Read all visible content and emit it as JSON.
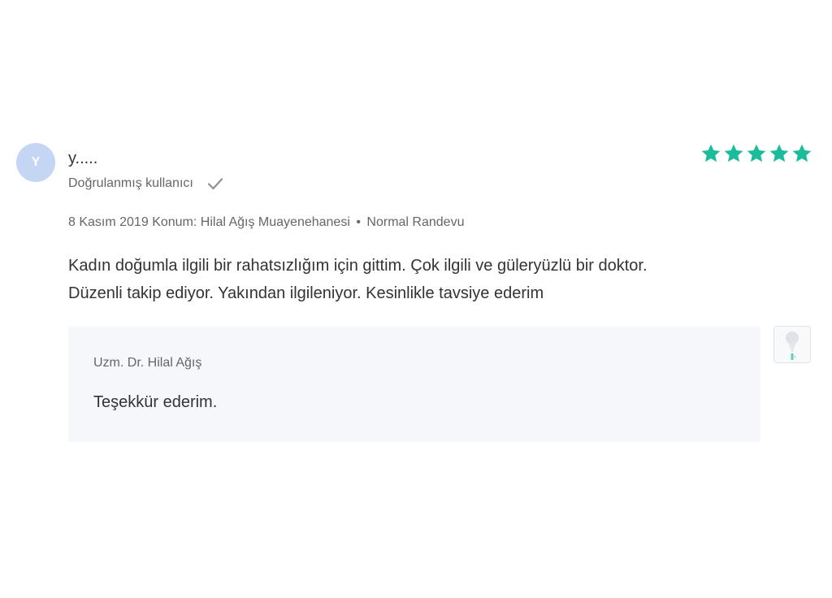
{
  "review": {
    "avatar_initial": "Y",
    "author_name": "y.....",
    "verified_label": "Doğrulanmış kullanıcı",
    "rating": 5,
    "rating_max": 5,
    "star_color": "#1abc9c",
    "date": "8 Kasım 2019",
    "location": "Konum: Hilal Ağış Muayenehanesi",
    "separator": "•",
    "appointment_type": "Normal Randevu",
    "text_line1": "Kadın doğumla ilgili bir rahatsızlığım için gittim. Çok ilgili ve güleryüzlü bir doktor.",
    "text_line2": "Düzenli takip ediyor. Yakından ilgileniyor. Kesinlikle tavsiye ederim"
  },
  "reply": {
    "author": "Uzm. Dr. Hilal Ağış",
    "text": "Teşekkür ederim."
  },
  "icons": {
    "verified": "check-icon",
    "star": "star-icon",
    "doctor_avatar": "doctor-avatar-icon"
  }
}
